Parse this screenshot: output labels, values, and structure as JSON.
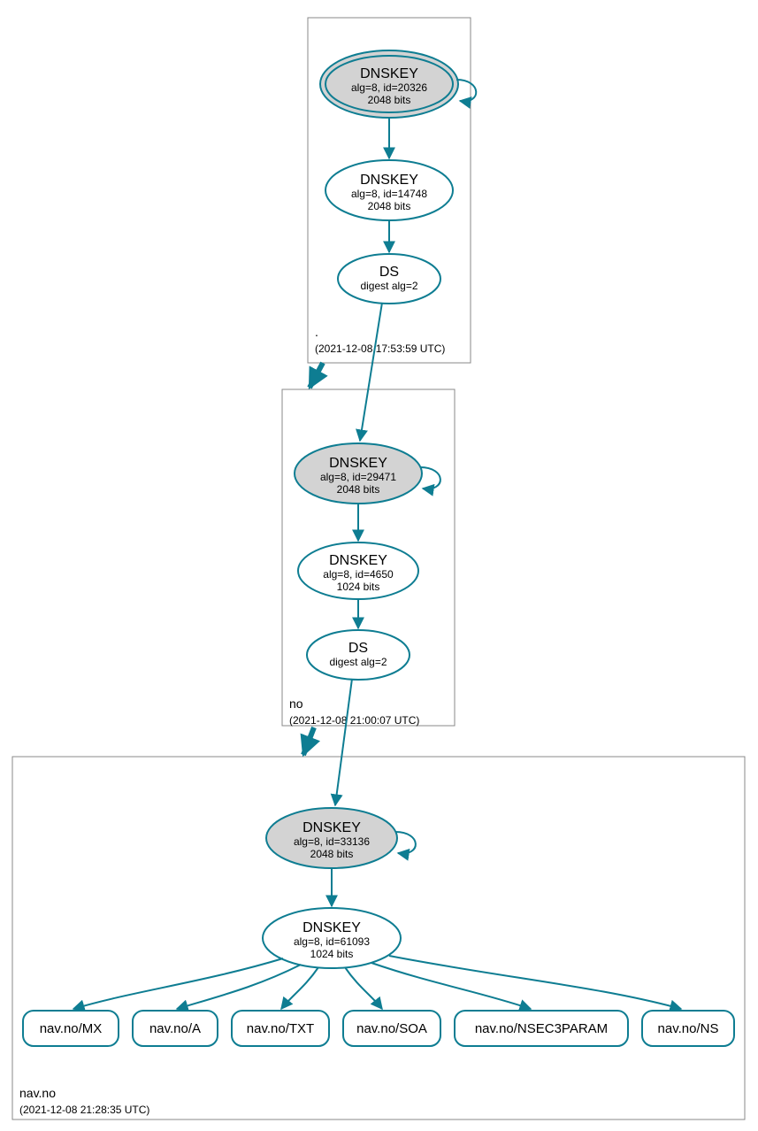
{
  "colors": {
    "teal": "#0e7d92",
    "ksk_fill": "#d3d3d3",
    "box_stroke": "#888"
  },
  "zones": [
    {
      "name_label": ".",
      "time_label": "(2021-12-08 17:53:59 UTC)"
    },
    {
      "name_label": "no",
      "time_label": "(2021-12-08 21:00:07 UTC)"
    },
    {
      "name_label": "nav.no",
      "time_label": "(2021-12-08 21:28:35 UTC)"
    }
  ],
  "root_ksk": {
    "title": "DNSKEY",
    "line2": "alg=8, id=20326",
    "line3": "2048 bits"
  },
  "root_zsk": {
    "title": "DNSKEY",
    "line2": "alg=8, id=14748",
    "line3": "2048 bits"
  },
  "root_ds": {
    "title": "DS",
    "line2": "digest alg=2"
  },
  "no_ksk": {
    "title": "DNSKEY",
    "line2": "alg=8, id=29471",
    "line3": "2048 bits"
  },
  "no_zsk": {
    "title": "DNSKEY",
    "line2": "alg=8, id=4650",
    "line3": "1024 bits"
  },
  "no_ds": {
    "title": "DS",
    "line2": "digest alg=2"
  },
  "navno_ksk": {
    "title": "DNSKEY",
    "line2": "alg=8, id=33136",
    "line3": "2048 bits"
  },
  "navno_zsk": {
    "title": "DNSKEY",
    "line2": "alg=8, id=61093",
    "line3": "1024 bits"
  },
  "leaves": [
    "nav.no/MX",
    "nav.no/A",
    "nav.no/TXT",
    "nav.no/SOA",
    "nav.no/NSEC3PARAM",
    "nav.no/NS"
  ]
}
